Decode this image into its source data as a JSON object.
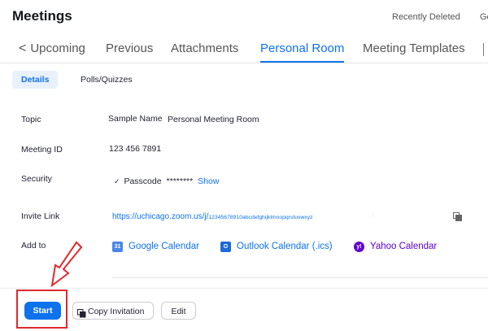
{
  "header": {
    "title": "Meetings",
    "recently_deleted": "Recently Deleted",
    "cut_link": "Ge"
  },
  "tabs": [
    {
      "label": "Upcoming",
      "prefix": "<"
    },
    {
      "label": "Previous"
    },
    {
      "label": "Attachments"
    },
    {
      "label": "Personal Room",
      "active": true
    },
    {
      "label": "Meeting Templates"
    }
  ],
  "subtabs": {
    "details": "Details",
    "polls": "Polls/Quizzes"
  },
  "details": {
    "topic": {
      "label": "Topic",
      "name": "Sample Name",
      "value": "Personal Meeting Room"
    },
    "meeting_id": {
      "label": "Meeting ID",
      "value": "123 456 7891"
    },
    "security": {
      "label": "Security",
      "check": "✓",
      "passcode_label": "Passcode",
      "passcode_mask": "********",
      "show": "Show"
    },
    "invite": {
      "label": "Invite Link",
      "url_host": "https://uchicago.zoom.us/j/",
      "url_id": "12345678910abcdefghijklmnopqrstuvwxyz",
      "dot": ":"
    },
    "add_to": {
      "label": "Add to",
      "google": "Google Calendar",
      "google_icon_text": "31",
      "outlook": "Outlook Calendar (.ics)",
      "outlook_icon_text": "O",
      "yahoo": "Yahoo Calendar",
      "yahoo_icon_text": "y!"
    }
  },
  "actions": {
    "start": "Start",
    "copy_invitation": "Copy Invitation",
    "edit": "Edit"
  },
  "colors": {
    "accent": "#0e72ed",
    "highlight": "#e0282d",
    "yahoo": "#6001d2"
  },
  "icons": {
    "copy": "copy-icon",
    "google": "google-calendar-icon",
    "outlook": "outlook-icon",
    "yahoo": "yahoo-icon"
  }
}
